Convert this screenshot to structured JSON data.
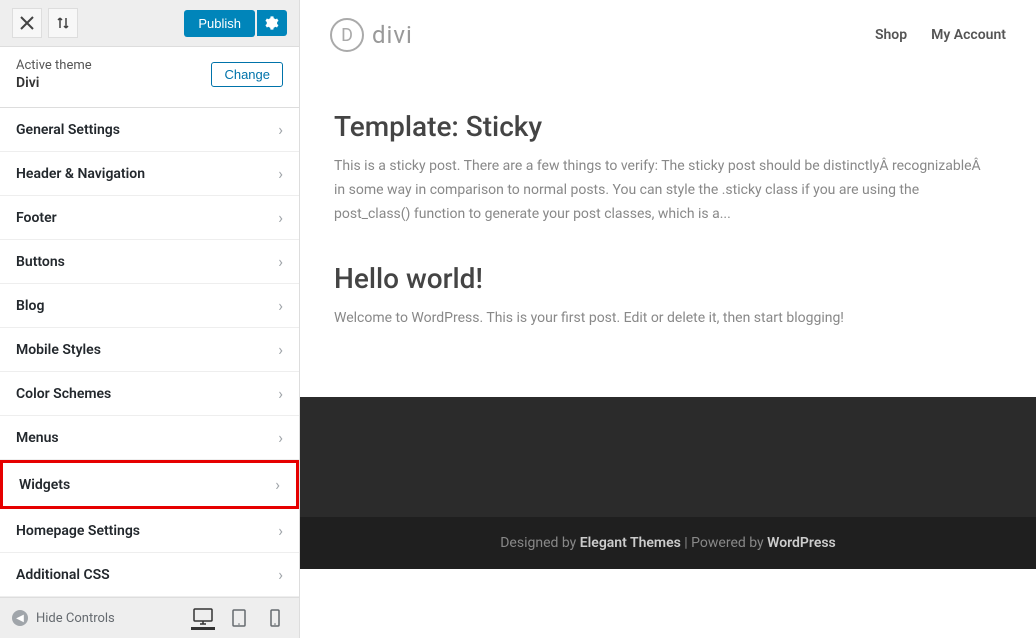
{
  "topbar": {
    "publish_label": "Publish"
  },
  "theme": {
    "active_label": "Active theme",
    "name": "Divi",
    "change_label": "Change"
  },
  "menu_items": [
    {
      "label": "General Settings",
      "highlight": false
    },
    {
      "label": "Header & Navigation",
      "highlight": false
    },
    {
      "label": "Footer",
      "highlight": false
    },
    {
      "label": "Buttons",
      "highlight": false
    },
    {
      "label": "Blog",
      "highlight": false
    },
    {
      "label": "Mobile Styles",
      "highlight": false
    },
    {
      "label": "Color Schemes",
      "highlight": false
    },
    {
      "label": "Menus",
      "highlight": false
    },
    {
      "label": "Widgets",
      "highlight": true
    },
    {
      "label": "Homepage Settings",
      "highlight": false
    },
    {
      "label": "Additional CSS",
      "highlight": false
    }
  ],
  "bottom": {
    "hide_controls_label": "Hide Controls"
  },
  "site": {
    "logo_letter": "D",
    "logo_text": "divi",
    "nav": [
      "Shop",
      "My Account"
    ]
  },
  "posts": [
    {
      "title": "Template: Sticky",
      "body": "This is a sticky post. There are a few things to verify: The sticky post should be distinctlyÂ recognizableÂ in some way in comparison to normal posts. You can style the .sticky class if you are using the post_class() function to generate your post classes, which is a..."
    },
    {
      "title": "Hello world!",
      "body": "Welcome to WordPress. This is your first post. Edit or delete it, then start blogging!"
    }
  ],
  "footer": {
    "prefix": "Designed by ",
    "link1": "Elegant Themes",
    "sep": " | Powered by ",
    "link2": "WordPress"
  }
}
